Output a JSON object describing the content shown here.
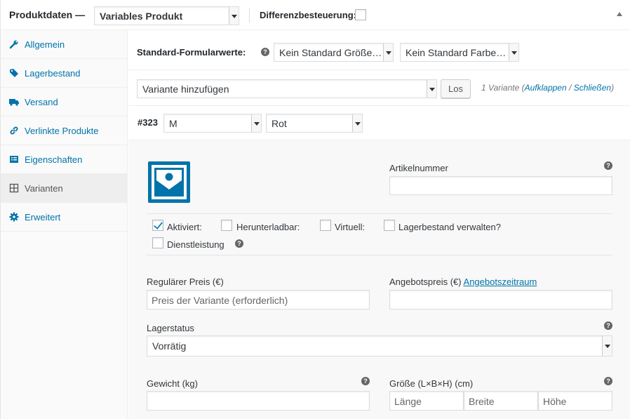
{
  "header": {
    "title": "Produktdaten —",
    "product_type": "Variables Produkt",
    "tax_label": "Differenzbesteuerung:"
  },
  "sidebar": {
    "items": [
      {
        "label": "Allgemein",
        "icon": "wrench-icon"
      },
      {
        "label": "Lagerbestand",
        "icon": "tag-icon"
      },
      {
        "label": "Versand",
        "icon": "truck-icon"
      },
      {
        "label": "Verlinkte Produkte",
        "icon": "link-icon"
      },
      {
        "label": "Eigenschaften",
        "icon": "list-icon"
      },
      {
        "label": "Varianten",
        "icon": "grid-icon"
      },
      {
        "label": "Erweitert",
        "icon": "gear-icon"
      }
    ],
    "active": "Varianten"
  },
  "defaults": {
    "label": "Standard-Formularwerte:",
    "size_select": "Kein Standard Größe…",
    "color_select": "Kein Standard Farbe…"
  },
  "variation_actions": {
    "select": "Variante hinzufügen",
    "go_button": "Los",
    "count": "1 Variante",
    "open_link": "Aufklappen",
    "separator": "/",
    "close_link": "Schließen",
    "paren_open": "(",
    "paren_close": ")"
  },
  "variation": {
    "id": "#323",
    "size": "M",
    "color": "Rot",
    "sku_label": "Artikelnummer",
    "options": {
      "enabled": "Aktiviert:",
      "downloadable": "Herunterladbar:",
      "virtual": "Virtuell:",
      "manage_stock": "Lagerbestand verwalten?",
      "service": "Dienstleistung"
    },
    "regular_price_label": "Regulärer Preis (€)",
    "regular_price_placeholder": "Preis der Variante (erforderlich)",
    "sale_price_label": "Angebotspreis (€)",
    "sale_schedule_link": "Angebotszeitraum",
    "stock_status_label": "Lagerstatus",
    "stock_status_value": "Vorrätig",
    "weight_label": "Gewicht (kg)",
    "dimensions_label": "Größe (L×B×H) (cm)",
    "length_placeholder": "Länge",
    "width_placeholder": "Breite",
    "height_placeholder": "Höhe"
  },
  "colors": {
    "accent": "#0073aa",
    "checkbox_check": "#1e8cbe"
  }
}
